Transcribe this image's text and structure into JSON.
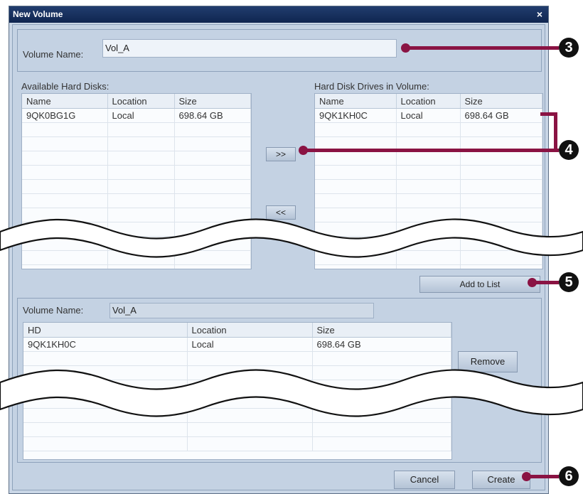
{
  "window": {
    "title": "New Volume",
    "close": "×"
  },
  "volume_name": {
    "label": "Volume Name:",
    "value": "Vol_A"
  },
  "available": {
    "label": "Available Hard Disks:",
    "columns": [
      "Name",
      "Location",
      "Size"
    ],
    "rows": [
      [
        "9QK0BG1G",
        "Local",
        "698.64 GB"
      ]
    ]
  },
  "in_volume": {
    "label": "Hard Disk Drives in Volume:",
    "columns": [
      "Name",
      "Location",
      "Size"
    ],
    "rows": [
      [
        "9QK1KH0C",
        "Local",
        "698.64 GB"
      ]
    ]
  },
  "buttons": {
    "add": ">>",
    "remove_from": "<<",
    "add_to_list": "Add to List",
    "remove": "Remove",
    "cancel": "Cancel",
    "create": "Create"
  },
  "list": {
    "volume_label": "Volume Name:",
    "volume_value": "Vol_A",
    "columns": [
      "HD",
      "Location",
      "Size"
    ],
    "rows": [
      [
        "9QK1KH0C",
        "Local",
        "698.64 GB"
      ]
    ]
  },
  "callouts": [
    "3",
    "4",
    "5",
    "6"
  ],
  "colors": {
    "callout": "#8a1343",
    "title_bar": "#1a3463",
    "panel": "#c4d2e3"
  }
}
